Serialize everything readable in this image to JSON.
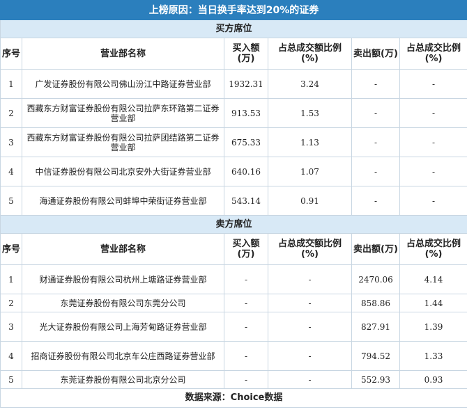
{
  "title": "上榜原因：当日换手率达到20%的证券",
  "buy_section": "买方席位",
  "sell_section": "卖方席位",
  "columns": [
    "序号",
    "营业部名称",
    "买入额(万)",
    "占总成交额比例(%)",
    "卖出额(万)",
    "占总成交比例(%)"
  ],
  "buy_rows": [
    {
      "no": "1",
      "name": "广发证券股份有限公司佛山汾江中路证券营业部",
      "buy": "1932.31",
      "buy_pct": "3.24",
      "sell": "-",
      "sell_pct": "-"
    },
    {
      "no": "2",
      "name": "西藏东方财富证券股份有限公司拉萨东环路第二证券营业部",
      "buy": "913.53",
      "buy_pct": "1.53",
      "sell": "-",
      "sell_pct": "-"
    },
    {
      "no": "3",
      "name": "西藏东方财富证券股份有限公司拉萨团结路第二证券营业部",
      "buy": "675.33",
      "buy_pct": "1.13",
      "sell": "-",
      "sell_pct": "-"
    },
    {
      "no": "4",
      "name": "中信证券股份有限公司北京安外大街证券营业部",
      "buy": "640.16",
      "buy_pct": "1.07",
      "sell": "-",
      "sell_pct": "-"
    },
    {
      "no": "5",
      "name": "海通证券股份有限公司蚌埠中荣街证券营业部",
      "buy": "543.14",
      "buy_pct": "0.91",
      "sell": "-",
      "sell_pct": "-"
    }
  ],
  "sell_rows": [
    {
      "no": "1",
      "name": "财通证券股份有限公司杭州上塘路证券营业部",
      "buy": "-",
      "buy_pct": "-",
      "sell": "2470.06",
      "sell_pct": "4.14"
    },
    {
      "no": "2",
      "name": "东莞证券股份有限公司东莞分公司",
      "buy": "-",
      "buy_pct": "-",
      "sell": "858.86",
      "sell_pct": "1.44"
    },
    {
      "no": "3",
      "name": "光大证券股份有限公司上海芳甸路证券营业部",
      "buy": "-",
      "buy_pct": "-",
      "sell": "827.91",
      "sell_pct": "1.39"
    },
    {
      "no": "4",
      "name": "招商证券股份有限公司北京车公庄西路证券营业部",
      "buy": "-",
      "buy_pct": "-",
      "sell": "794.52",
      "sell_pct": "1.33"
    },
    {
      "no": "5",
      "name": "东莞证券股份有限公司北京分公司",
      "buy": "-",
      "buy_pct": "-",
      "sell": "552.93",
      "sell_pct": "0.93"
    }
  ],
  "footer": "数据来源：Choice数据",
  "colors": {
    "title_bg": "#2b7fbd",
    "section_bg": "#d8e9f6",
    "border": "#c8d6e2"
  }
}
